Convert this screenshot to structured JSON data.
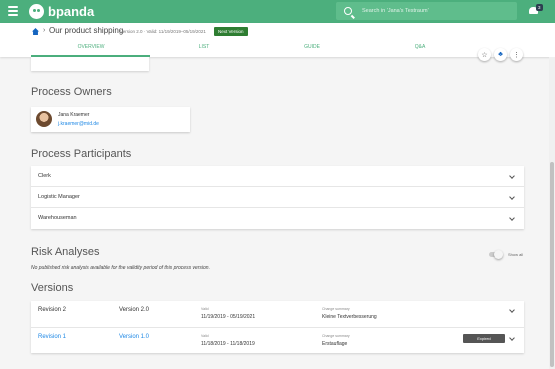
{
  "app": {
    "brand": "bpanda",
    "search_placeholder": "Search in 'Jana's Testraum'",
    "badge": "3"
  },
  "header": {
    "title": "Our product shipping",
    "meta": "Version 2.0 · Valid: 11/19/2019–05/19/2021",
    "next_version": "Next Version",
    "tabs": [
      "OVERVIEW",
      "LIST",
      "GUIDE",
      "Q&A"
    ]
  },
  "owners": {
    "title": "Process Owners",
    "name": "Jana Kraemer",
    "email": "j.kraemer@mid.de"
  },
  "participants": {
    "title": "Process Participants",
    "items": [
      "Clerk",
      "Logistic Manager",
      "Warehouseman"
    ]
  },
  "risk": {
    "title": "Risk Analyses",
    "show_all": "Show all",
    "note": "No published risk analysis available for the validity period of this process version."
  },
  "versions": {
    "title": "Versions",
    "rows": [
      {
        "revision": "Revision 2",
        "version": "Version 2.0",
        "valid_label": "Valid",
        "valid": "11/19/2019 - 05/19/2021",
        "summary_label": "Change summary",
        "summary": "Kleine Textverbesserung",
        "status": ""
      },
      {
        "revision": "Revision 1",
        "version": "Version  1.0",
        "valid_label": "Valid",
        "valid": "11/18/2019 - 11/18/2019",
        "summary_label": "Change summary",
        "summary": "Erstauflage",
        "status": "Expired"
      }
    ]
  },
  "colors": {
    "brand_green": "#4caf7d",
    "link_blue": "#1e88e5"
  }
}
